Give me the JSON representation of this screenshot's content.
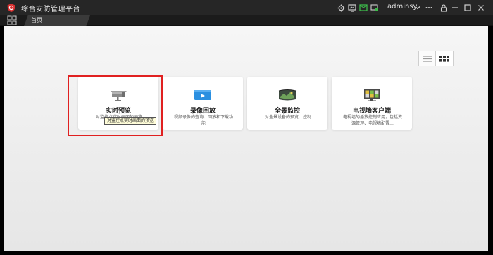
{
  "app": {
    "title": "综合安防管理平台",
    "brand_color": "#d93030"
  },
  "titlebar": {
    "username": "adminsy",
    "icons": [
      "settings-icon",
      "monitor-icon",
      "message-icon",
      "screen-status-icon",
      "chevron-down-icon",
      "more-icon",
      "lock-icon",
      "minimize-icon",
      "maximize-icon",
      "close-icon"
    ]
  },
  "tabs": [
    {
      "label": "首页"
    }
  ],
  "view_toggle": {
    "options": [
      "list",
      "grid"
    ],
    "selected": "grid"
  },
  "cards": [
    {
      "title": "实时预览",
      "desc": "对监控点实时画面的预览",
      "icon": "camera-icon"
    },
    {
      "title": "录像回放",
      "desc": "视频录像的查询、回放和下载功能",
      "icon": "playback-icon"
    },
    {
      "title": "全景监控",
      "desc": "对全景设备的预览、控制",
      "icon": "panorama-icon"
    },
    {
      "title": "电视墙客户端",
      "desc": "电视墙的播放控制应用，包括资源管理、电视墙配置...",
      "icon": "tv-wall-icon"
    }
  ],
  "tooltip": {
    "text": "对监控点实时画面的预览"
  },
  "colors": {
    "highlight": "#e02020",
    "accent": "#2a8fe0"
  }
}
